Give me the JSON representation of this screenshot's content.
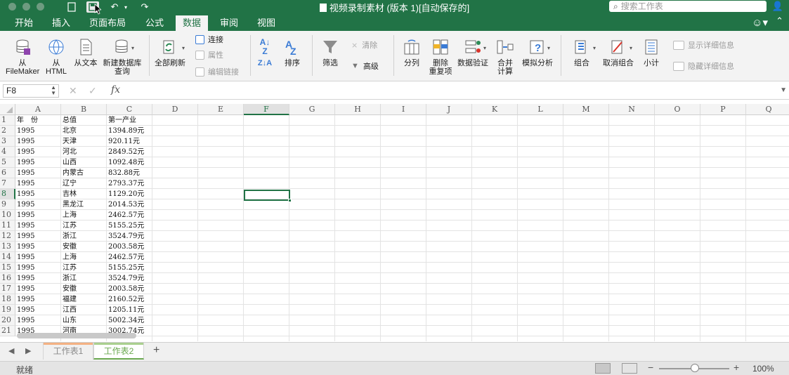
{
  "window": {
    "title": "视频录制素材 (版本 1)[自动保存的]",
    "search_placeholder": "搜索工作表",
    "accent_color": "#217346"
  },
  "tabs": [
    {
      "label": "开始"
    },
    {
      "label": "插入"
    },
    {
      "label": "页面布局"
    },
    {
      "label": "公式"
    },
    {
      "label": "数据",
      "active": true
    },
    {
      "label": "审阅"
    },
    {
      "label": "视图"
    }
  ],
  "ribbon": {
    "from_filemaker": "从\nFileMaker",
    "from_html": "从\nHTML",
    "from_text": "从文本",
    "new_db_query": "新建数据库\n查询",
    "refresh_all": "全部刷新",
    "connections": "连接",
    "properties": "属性",
    "edit_links": "编辑链接",
    "sort": "排序",
    "filter": "筛选",
    "clear": "清除",
    "advanced": "高级",
    "text_to_columns": "分列",
    "remove_duplicates": "删除\n重复项",
    "data_validation": "数据验证",
    "consolidate": "合并\n计算",
    "what_if": "模拟分析",
    "group": "组合",
    "ungroup": "取消组合",
    "subtotal": "小计",
    "show_detail": "显示详细信息",
    "hide_detail": "隐藏详细信息"
  },
  "formula_bar": {
    "name_box": "F8",
    "fx_label": "fx",
    "value": ""
  },
  "grid": {
    "columns": [
      "A",
      "B",
      "C",
      "D",
      "E",
      "F",
      "G",
      "H",
      "I",
      "J",
      "K",
      "L",
      "M",
      "N",
      "O",
      "P",
      "Q"
    ],
    "selected_column": "F",
    "selected_row": 8,
    "row_numbers": [
      "1",
      "2",
      "3",
      "4",
      "5",
      "6",
      "7",
      "8",
      "9",
      "10",
      "11",
      "12",
      "13",
      "14",
      "15",
      "16",
      "17",
      "18",
      "19",
      "20",
      "21"
    ],
    "rows": [
      [
        "年　份",
        "总值",
        "第一产业"
      ],
      [
        "1995",
        "北京",
        "1394.89元"
      ],
      [
        "1995",
        "天津",
        "920.11元"
      ],
      [
        "1995",
        "河北",
        "2849.52元"
      ],
      [
        "1995",
        "山西",
        "1092.48元"
      ],
      [
        "1995",
        "内蒙古",
        "832.88元"
      ],
      [
        "1995",
        "辽宁",
        "2793.37元"
      ],
      [
        "1995",
        "吉林",
        "1129.20元"
      ],
      [
        "1995",
        "黑龙江",
        "2014.53元"
      ],
      [
        "1995",
        "上海",
        "2462.57元"
      ],
      [
        "1995",
        "江苏",
        "5155.25元"
      ],
      [
        "1995",
        "浙江",
        "3524.79元"
      ],
      [
        "1995",
        "安徽",
        "2003.58元"
      ],
      [
        "1995",
        "上海",
        "2462.57元"
      ],
      [
        "1995",
        "江苏",
        "5155.25元"
      ],
      [
        "1995",
        "浙江",
        "3524.79元"
      ],
      [
        "1995",
        "安徽",
        "2003.58元"
      ],
      [
        "1995",
        "福建",
        "2160.52元"
      ],
      [
        "1995",
        "江西",
        "1205.11元"
      ],
      [
        "1995",
        "山东",
        "5002.34元"
      ],
      [
        "1995",
        "河南",
        "3002.74元"
      ]
    ]
  },
  "sheets": [
    {
      "label": "工作表1",
      "active": false
    },
    {
      "label": "工作表2",
      "active": true
    }
  ],
  "status": {
    "text": "就绪",
    "zoom": "100%",
    "zoom_level": 1.0
  }
}
